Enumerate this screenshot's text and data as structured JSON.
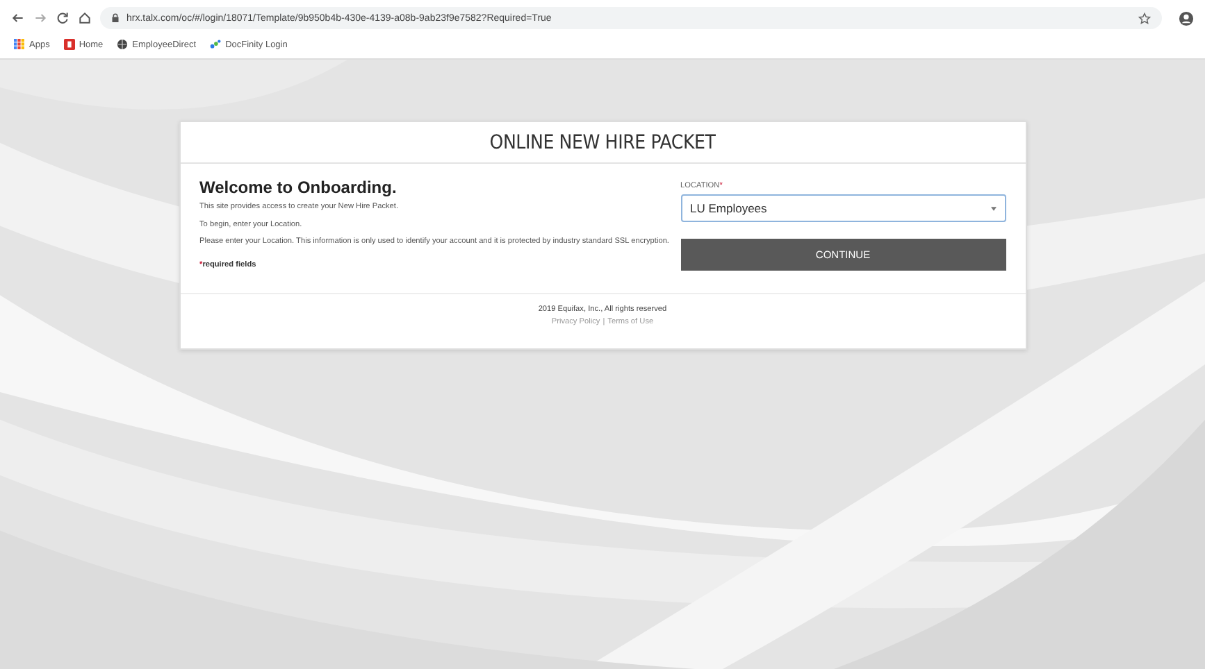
{
  "browser": {
    "url": "hrx.talx.com/oc/#/login/18071/Template/9b950b4b-430e-4139-a08b-9ab23f9e7582?Required=True",
    "bookmarks": [
      {
        "label": "Apps",
        "kind": "apps"
      },
      {
        "label": "Home",
        "kind": "home"
      },
      {
        "label": "EmployeeDirect",
        "kind": "globe"
      },
      {
        "label": "DocFinity Login",
        "kind": "dots"
      }
    ]
  },
  "card": {
    "title": "ONLINE NEW HIRE PACKET",
    "heading": "Welcome to Onboarding.",
    "paragraphs": [
      "This site provides access to create your New Hire Packet.",
      "To begin, enter your Location.",
      "Please enter your Location. This information is only used to identify your account and it is protected by industry standard SSL encryption."
    ],
    "required_mark": "*",
    "required_note": "required fields",
    "location": {
      "label": "LOCATION",
      "required_mark": "*",
      "value": "LU Employees"
    },
    "button": "CONTINUE",
    "footer": {
      "copyright": "2019 Equifax, Inc., All rights reserved",
      "links": [
        "Privacy Policy",
        "Terms of Use"
      ],
      "separator": "|"
    }
  }
}
